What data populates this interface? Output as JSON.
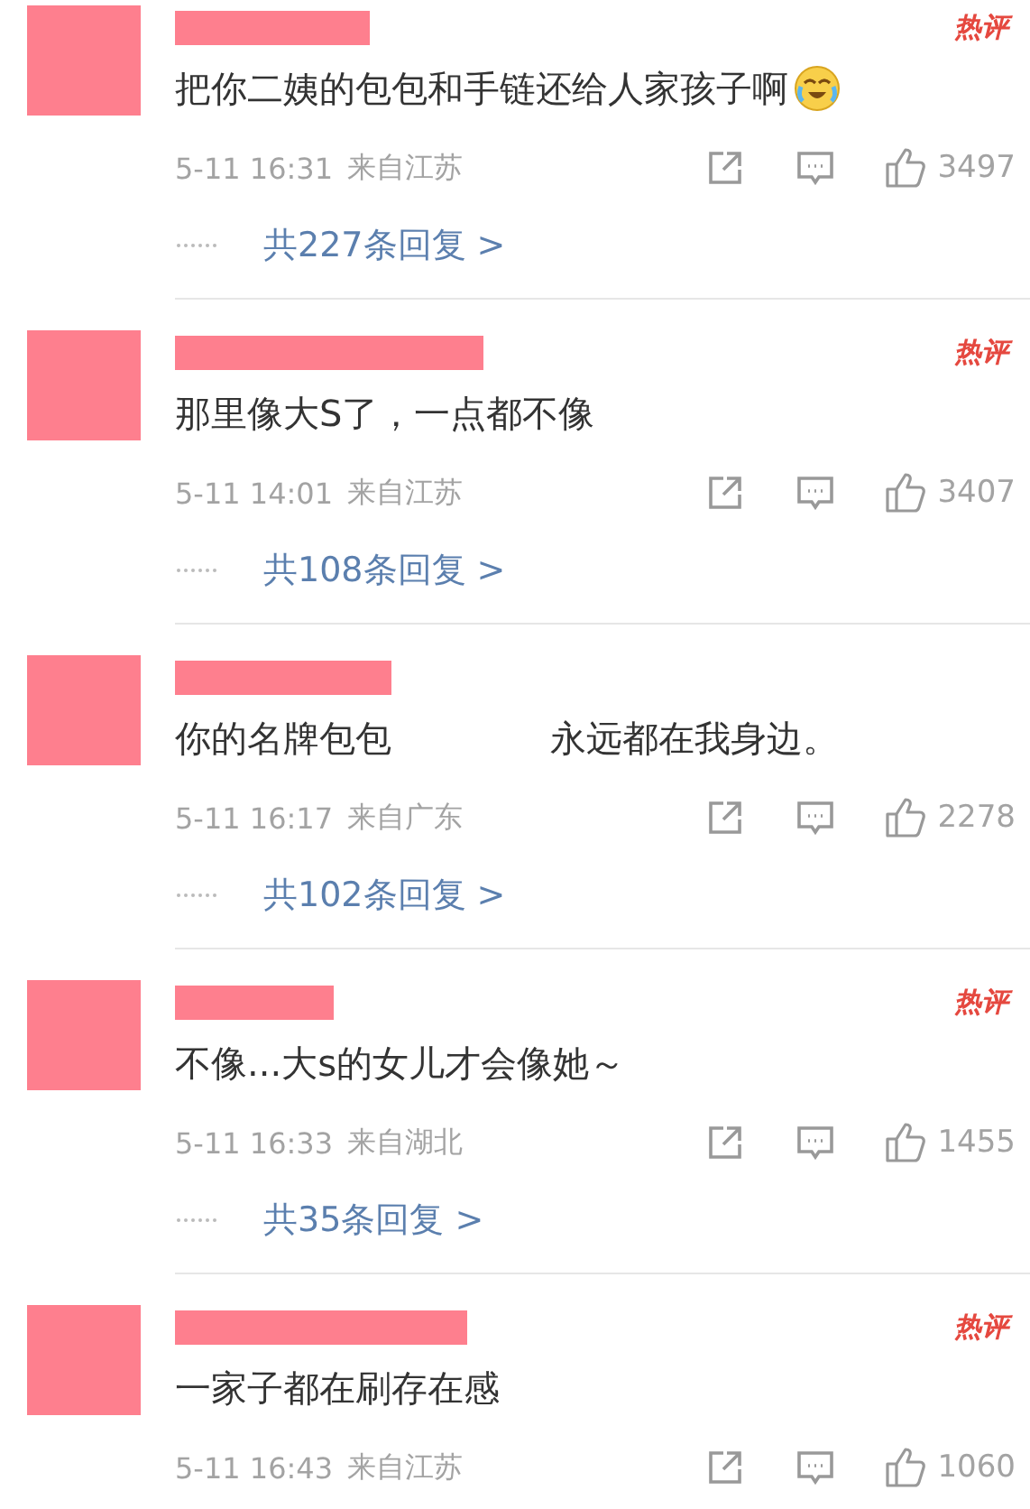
{
  "comments": [
    {
      "redacted": true,
      "badge": "热评",
      "content": "把你二姨的包包和手链还给人家孩子啊",
      "emoji": true,
      "time": "5-11 16:31",
      "location": "来自江苏",
      "likes": "3497",
      "replies": "共227条回复 >"
    },
    {
      "redacted": true,
      "badge": "热评",
      "content": "那里像大S了，一点都不像",
      "time": "5-11 14:01",
      "location": "来自江苏",
      "likes": "3407",
      "replies": "共108条回复 >"
    },
    {
      "redacted": true,
      "content": "你的名牌包包",
      "content_after": "永远都在我身边。",
      "time": "5-11 16:17",
      "location": "来自广东",
      "likes": "2278",
      "replies": "共102条回复 >"
    },
    {
      "redacted": true,
      "badge": "热评",
      "content": "不像...大s的女儿才会像她～",
      "time": "5-11 16:33",
      "location": "来自湖北",
      "likes": "1455",
      "replies": "共35条回复 >"
    },
    {
      "redacted": true,
      "badge": "热评",
      "content": "一家子都在刷存在感",
      "time": "5-11 16:43",
      "location": "来自江苏",
      "likes": "1060"
    }
  ]
}
